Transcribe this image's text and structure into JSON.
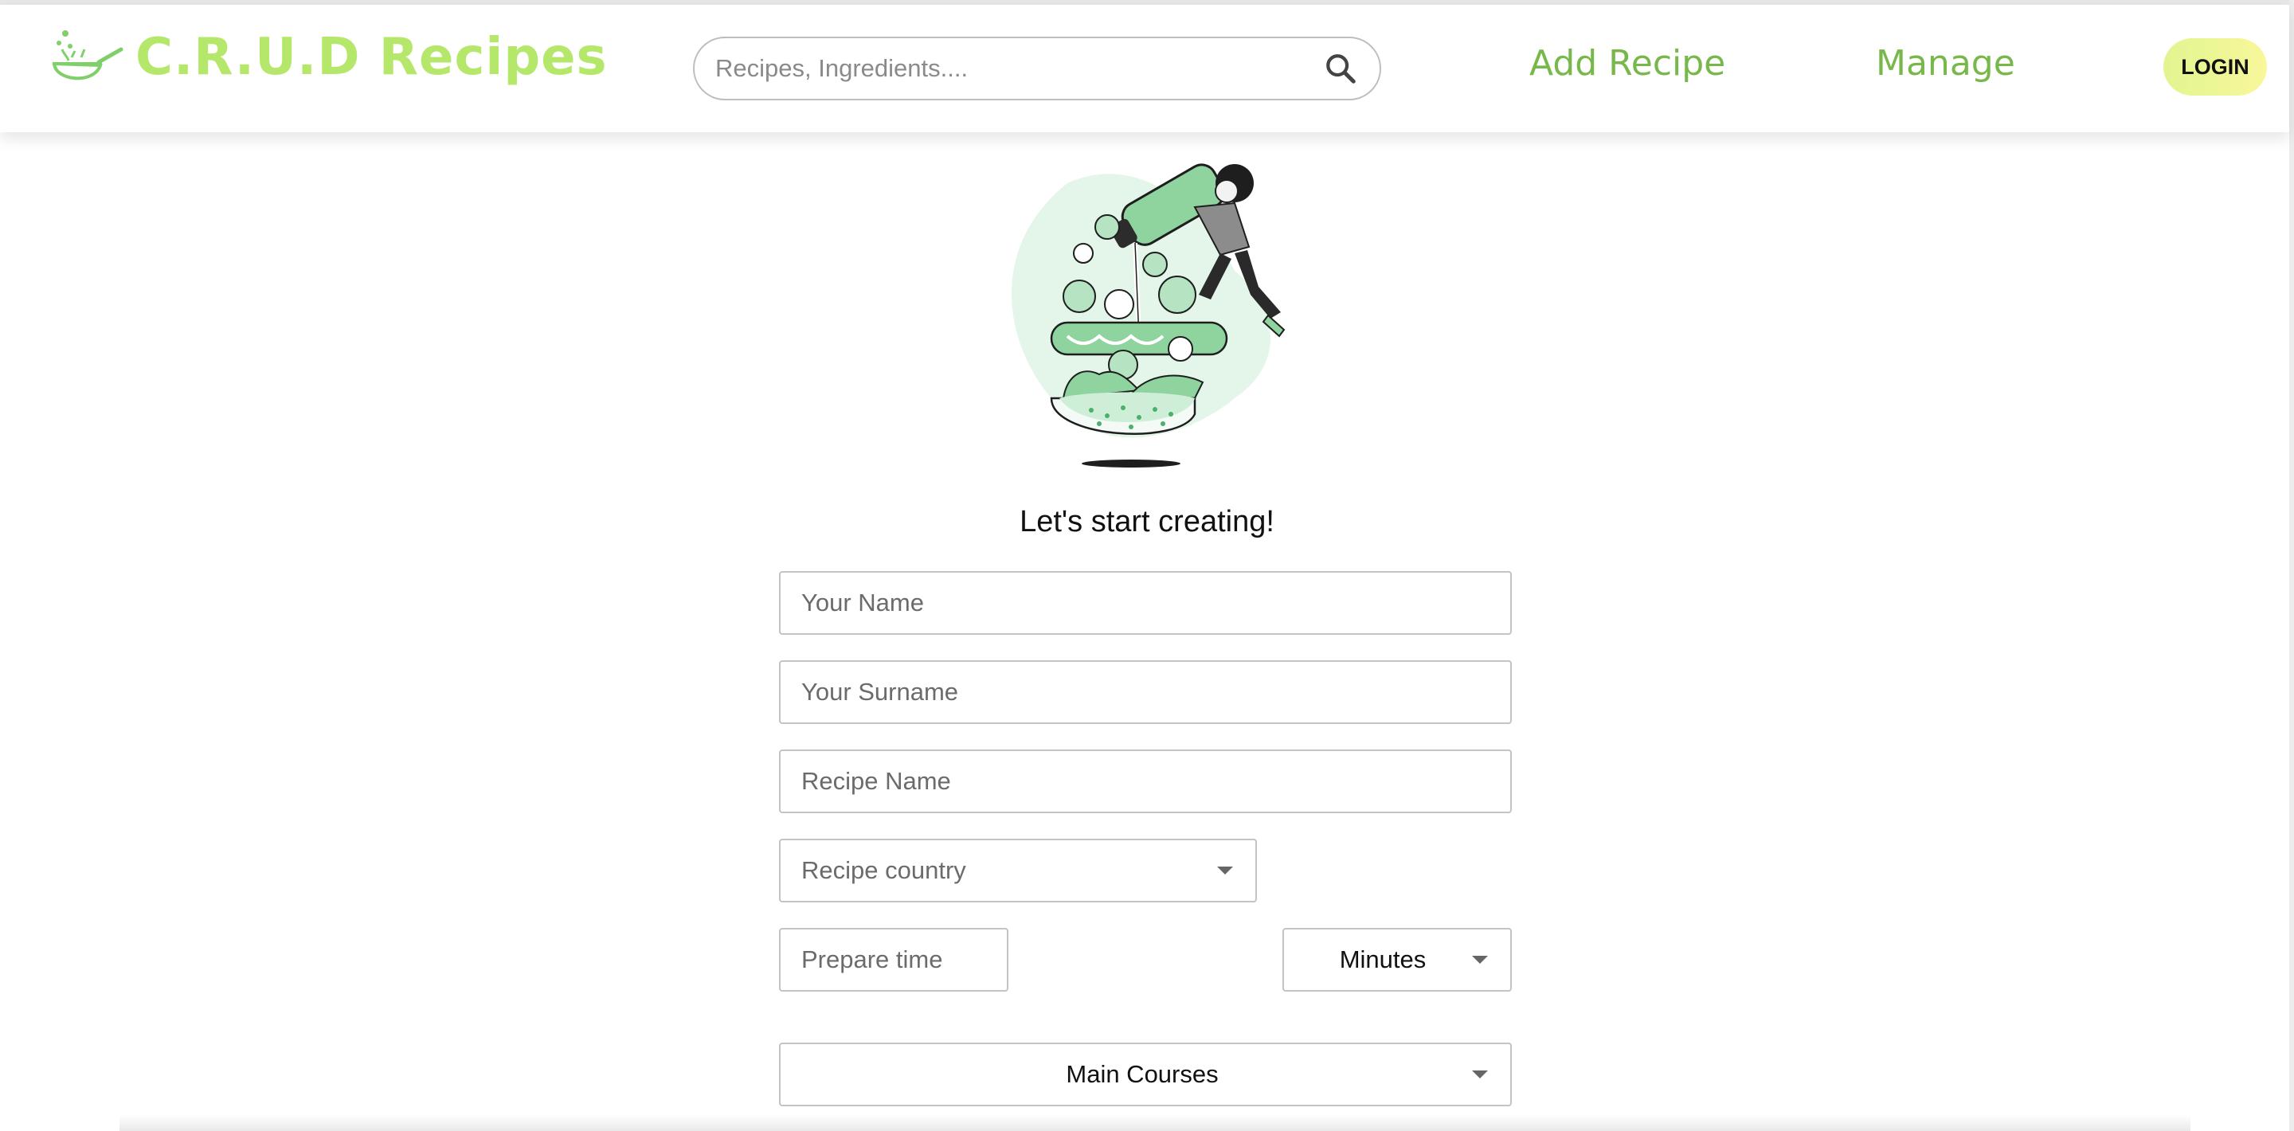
{
  "header": {
    "brand": "C.R.U.D Recipes",
    "search_placeholder": "Recipes, Ingredients....",
    "nav": {
      "add_recipe": "Add Recipe",
      "manage": "Manage"
    },
    "login": "LOGIN"
  },
  "main": {
    "headline": "Let's start creating!",
    "fields": {
      "name_placeholder": "Your Name",
      "surname_placeholder": "Your Surname",
      "recipe_name_placeholder": "Recipe Name",
      "country_placeholder": "Recipe country",
      "prepare_time_placeholder": "Prepare time",
      "time_unit": "Minutes",
      "category": "Main Courses"
    }
  },
  "colors": {
    "brand": "#b5e86a",
    "nav": "#78b84a",
    "login_gradient_start": "#e2f590",
    "login_gradient_end": "#f8f79b",
    "illustration_green": "#8fd49f",
    "illustration_bg": "#e4f5e9"
  },
  "icons": {
    "logo": "wok-with-spatula-icon",
    "search": "search-icon",
    "dropdown": "caret-down-icon"
  }
}
